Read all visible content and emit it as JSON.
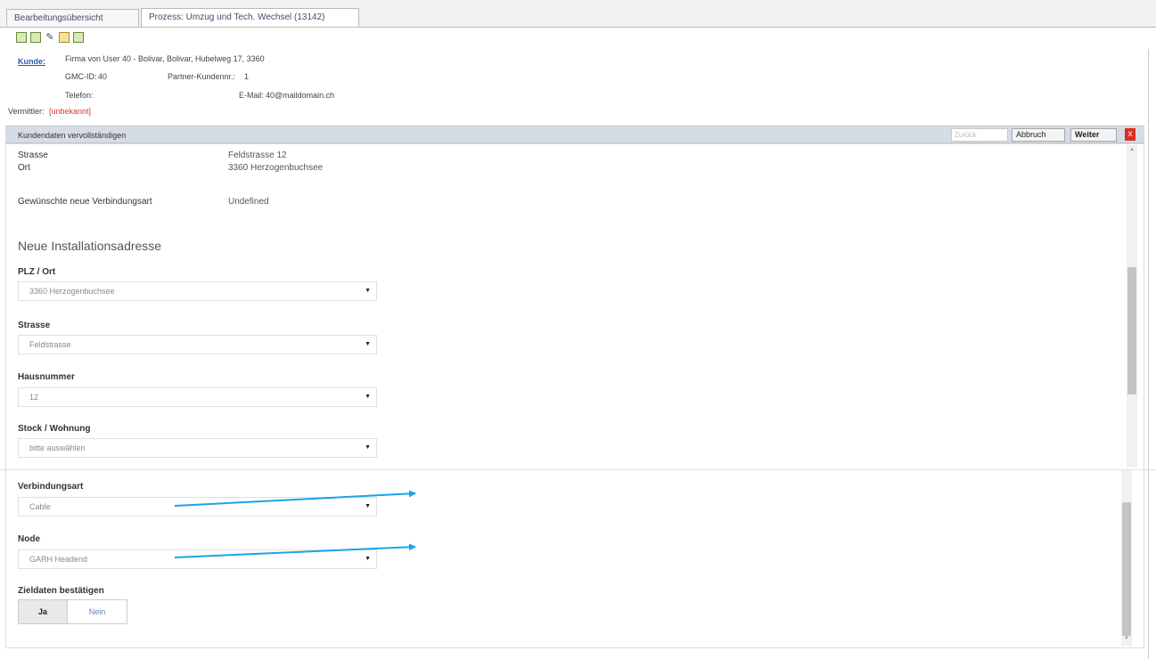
{
  "tabs": [
    {
      "label": "Bearbeitungsübersicht"
    },
    {
      "label": "Prozess: Umzug und Tech. Wechsel (13142)"
    }
  ],
  "toolbar": {
    "icons": [
      "save-icon",
      "export-icon",
      "edit-pencil-icon",
      "note-icon",
      "forward-icon"
    ]
  },
  "header": {
    "kunde_label": "Kunde:",
    "kunde_value": "Firma von User 40 - Bolivar, Bolivar, Hubelweg 17, 3360",
    "gmc_label": "GMC-ID:",
    "gmc_value": "40",
    "partner_label": "Partner-Kundennr.:",
    "partner_value": "1",
    "telefon_label": "Telefon:",
    "telefon_value": "",
    "email_label": "E-Mail:",
    "email_value": "40@maildomain.ch",
    "vermittler_label": "Vermittler:",
    "vermittler_value": "[unbekannt]"
  },
  "banner": {
    "title": "Kundendaten vervollständigen",
    "input_placeholder": "Zurück",
    "abbruch_label": "Abbruch",
    "weiter_label": "Weiter",
    "close_label": "x"
  },
  "current_address": {
    "strasse_label": "Strasse",
    "strasse_value": "Feldstrasse 12",
    "ort_label": "Ort",
    "ort_value": "3360 Herzogenbuchsee",
    "verbindungsart_label": "Gewünschte neue Verbindungsart",
    "verbindungsart_value": "Undefined"
  },
  "new_address": {
    "section_title": "Neue Installationsadresse",
    "plz_ort_label": "PLZ / Ort",
    "plz_ort_value": "3360 Herzogenbuchsee",
    "strasse_label": "Strasse",
    "strasse_value": "Feldstrasse",
    "hausnummer_label": "Hausnummer",
    "hausnummer_value": "12",
    "stock_label": "Stock / Wohnung",
    "stock_value": "bitte auswählen",
    "verbindungsart_label": "Verbindungsart",
    "verbindungsart_value": "Cable",
    "node_label": "Node",
    "node_value": "GARH Headend",
    "zieldaten_label": "Zieldaten bestätigen",
    "ja_label": "Ja",
    "nein_label": "Nein"
  },
  "colors": {
    "annotation_arrow": "#1aa3e8",
    "banner_bg": "#d6dce6",
    "link_blue": "#2d57b8",
    "close_red": "#d9301f"
  }
}
